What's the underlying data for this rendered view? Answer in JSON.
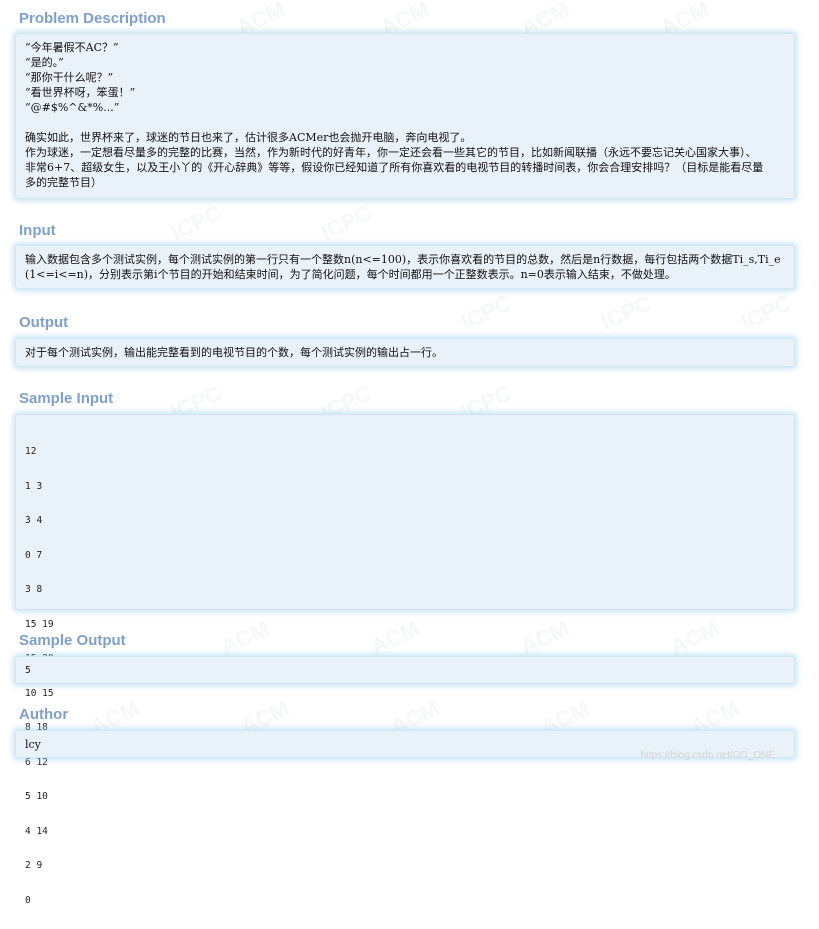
{
  "problem_description": {
    "title": "Problem Description",
    "lines": [
      "“今年暑假不AC？”",
      "“是的。”",
      "“那你干什么呢？”",
      "“看世界杯呀，笨蛋！”",
      "“@#$%^&*%...”",
      "",
      "确实如此，世界杯来了，球迷的节日也来了，估计很多ACMer也会抛开电脑，奔向电视了。",
      "作为球迷，一定想看尽量多的完整的比赛，当然，作为新时代的好青年，你一定还会看一些其它的节目，比如新闻联播（永远不要忘记关心国家大事）、",
      "非常6+7、超级女生，以及王小丫的《开心辞典》等等，假设你已经知道了所有你喜欢看的电视节目的转播时间表，你会合理安排吗？（目标是能看尽量",
      "多的完整节目）"
    ]
  },
  "input": {
    "title": "Input",
    "lines": [
      "输入数据包含多个测试实例，每个测试实例的第一行只有一个整数n(n<=100)，表示你喜欢看的节目的总数，然后是n行数据，每行包括两个数据Ti_s,Ti_e",
      "(1<=i<=n)，分别表示第i个节目的开始和结束时间，为了简化问题，每个时间都用一个正整数表示。n=0表示输入结束，不做处理。"
    ]
  },
  "output": {
    "title": "Output",
    "text": "对于每个测试实例，输出能完整看到的电视节目的个数，每个测试实例的输出占一行。"
  },
  "sample_input": {
    "title": "Sample Input",
    "lines": [
      "12",
      "1 3",
      "3 4",
      "0 7",
      "3 8",
      "15 19",
      "15 20",
      "10 15",
      "8 18",
      "6 12",
      "5 10",
      "4 14",
      "2 9",
      "0"
    ]
  },
  "sample_output": {
    "title": "Sample Output",
    "text": "5"
  },
  "author": {
    "title": "Author",
    "text": "lcy"
  },
  "footer": {
    "url": "https://blog.csdn.net/GD_ONE"
  },
  "colors": {
    "title": "#7ea1c8",
    "panel_bg": "#eaf2f9",
    "panel_glow": "#96cdeb"
  }
}
